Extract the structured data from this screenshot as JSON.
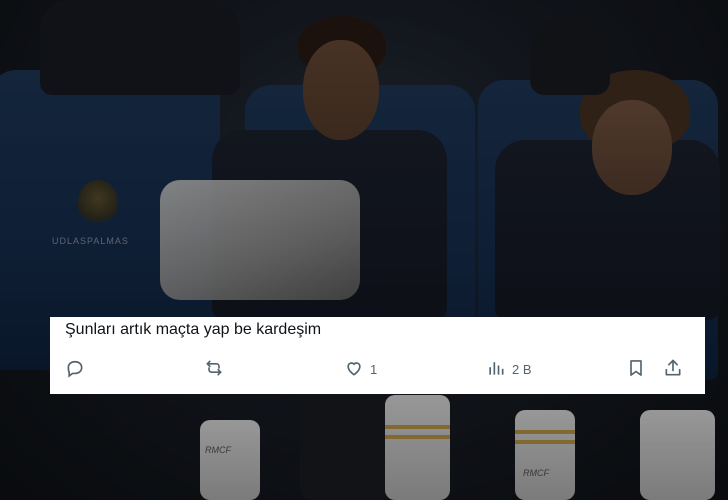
{
  "tweet": {
    "text": "Şunları artık maçta yap be kardeşim",
    "reply_count": "",
    "repost_count": "",
    "like_count": "1",
    "views_count": "2 B",
    "icons": {
      "reply": "reply-icon",
      "repost": "repost-icon",
      "like": "like-icon",
      "views": "views-icon",
      "bookmark": "bookmark-icon",
      "share": "share-icon"
    },
    "colors": {
      "text": "#0f1419",
      "icon": "#536471",
      "card_bg": "#ffffff"
    }
  },
  "background": {
    "seat_text": "UDLASPALMAS",
    "socks_text": "RMCF"
  }
}
